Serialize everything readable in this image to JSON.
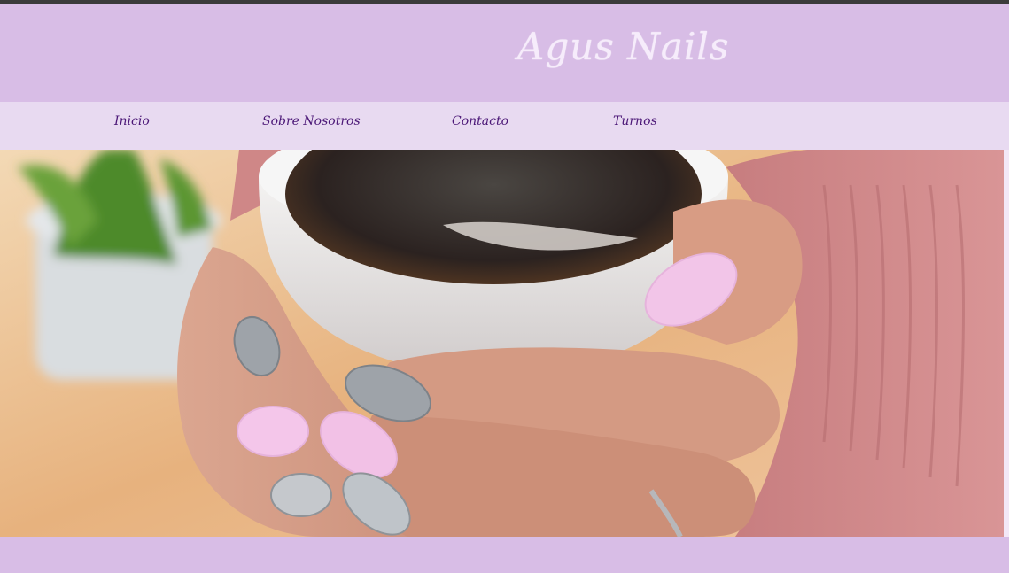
{
  "site": {
    "brand": "Agus Nails"
  },
  "nav": {
    "items": [
      {
        "label": "Inicio"
      },
      {
        "label": "Sobre Nosotros"
      },
      {
        "label": "Contacto"
      },
      {
        "label": "Turnos"
      }
    ]
  },
  "hero": {
    "image_subject": "hands-holding-coffee-cup-with-manicure"
  },
  "colors": {
    "header_bg": "#d8bde6",
    "nav_bg": "#e8daf1",
    "nav_text": "#4b1777",
    "brand_text": "#f6ecfb"
  }
}
